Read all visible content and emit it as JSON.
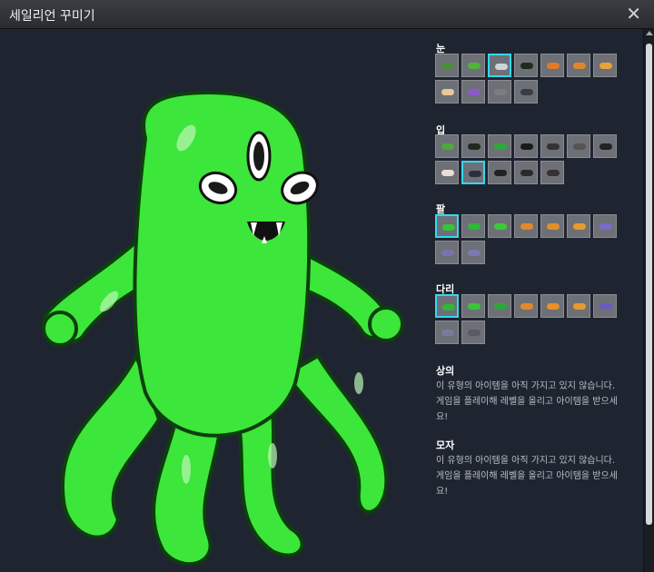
{
  "window": {
    "title": "세일리언 꾸미기",
    "close_icon": "close-icon"
  },
  "sections": {
    "eyes": {
      "label": "눈",
      "colors": [
        "#4b8b3a",
        "#4fb33b",
        "#cfd5d6",
        "#1d2d1a",
        "#e07a2a",
        "#e0862a",
        "#e8a33a",
        "#e8c99a",
        "#8b5ac8",
        "#7a7d82",
        "#3a3d42"
      ],
      "selected": 2
    },
    "mouth": {
      "label": "입",
      "colors": [
        "#4fa83b",
        "#1e2a1e",
        "#2ea83b",
        "#1a1a1a",
        "#333",
        "#555",
        "#222",
        "#e8e0d8",
        "#2a3040",
        "#222",
        "#2a2a2a",
        "#3a3030"
      ],
      "selected": 8
    },
    "arms": {
      "label": "팔",
      "colors": [
        "#35c43a",
        "#2fb83a",
        "#3acb3a",
        "#e08a2a",
        "#e0902a",
        "#e89a30",
        "#7a6ac8",
        "#7a72b0",
        "#7a7ab0"
      ],
      "selected": 0
    },
    "legs": {
      "label": "다리",
      "colors": [
        "#2fb83a",
        "#3ac43a",
        "#2ca83a",
        "#e08a2a",
        "#e8902a",
        "#e89a30",
        "#6a5ac0",
        "#7a7aa0",
        "#5a5a60"
      ],
      "selected": 0
    }
  },
  "top": {
    "heading": "상의",
    "message": "이 유형의 아이템을 아직 가지고 있지 않습니다. 게임을 플레이해 레벨을 올리고 아이템을 받으세요!"
  },
  "hat": {
    "heading": "모자",
    "message": "이 유형의 아이템을 아직 가지고 있지 않습니다. 게임을 플레이해 레벨을 올리고 아이템을 받으세요!"
  },
  "character": {
    "body_color": "#3fe03a",
    "outline_color": "#0f4a10"
  }
}
